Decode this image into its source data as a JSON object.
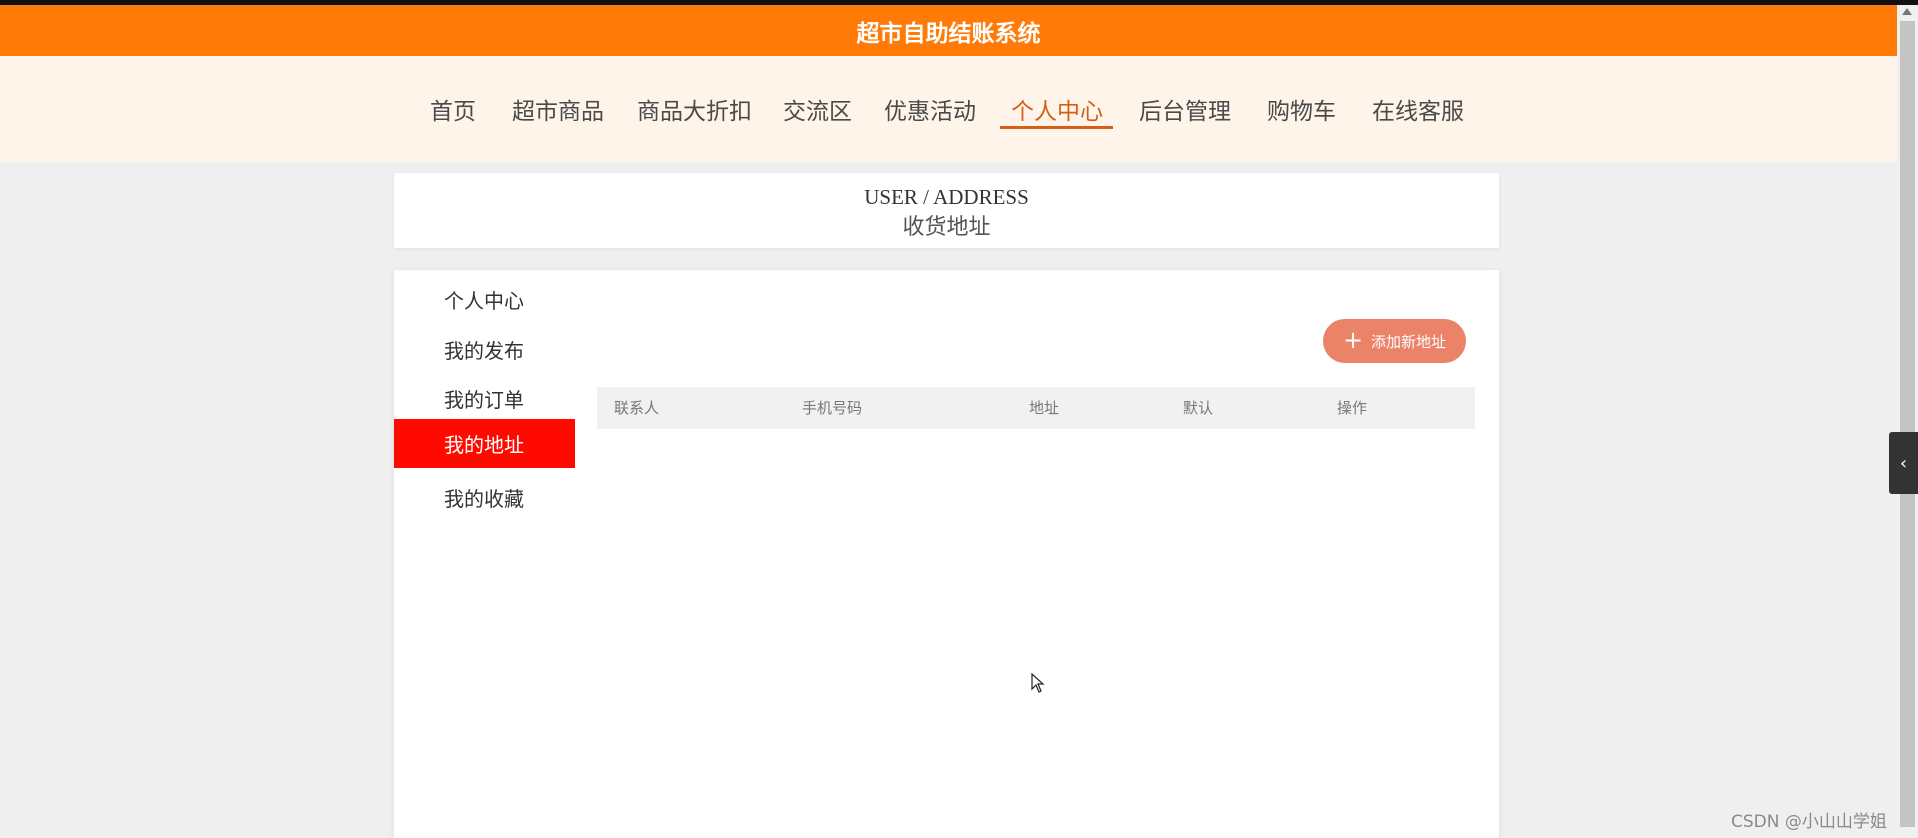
{
  "header": {
    "title": "超市自助结账系统"
  },
  "nav": {
    "items": [
      {
        "label": "首页"
      },
      {
        "label": "超市商品"
      },
      {
        "label": "商品大折扣"
      },
      {
        "label": "交流区"
      },
      {
        "label": "优惠活动"
      },
      {
        "label": "个人中心",
        "active": true
      },
      {
        "label": "后台管理"
      },
      {
        "label": "购物车"
      },
      {
        "label": "在线客服"
      }
    ],
    "active_color": "#d55f19"
  },
  "banner": {
    "english": "USER / ADDRESS",
    "chinese": "收货地址"
  },
  "sidebar": {
    "items": [
      {
        "label": "个人中心"
      },
      {
        "label": "我的发布"
      },
      {
        "label": "我的订单"
      },
      {
        "label": "我的地址",
        "active": true
      },
      {
        "label": "我的收藏"
      }
    ],
    "active_color": "#ff0a00"
  },
  "address": {
    "add_button_label": "添加新地址",
    "add_button_icon": "plus-icon",
    "columns": [
      "联系人",
      "手机号码",
      "地址",
      "默认",
      "操作"
    ],
    "rows": []
  },
  "floating_tab": {
    "icon": "chevron-left-icon",
    "glyph": "‹"
  },
  "watermark": {
    "text": "CSDN @小山山学姐"
  },
  "colors": {
    "title_bar": "#ff7a06",
    "nav_bg": "#fff4e9",
    "page_bg": "#efefef",
    "add_button": "#ea8368"
  }
}
